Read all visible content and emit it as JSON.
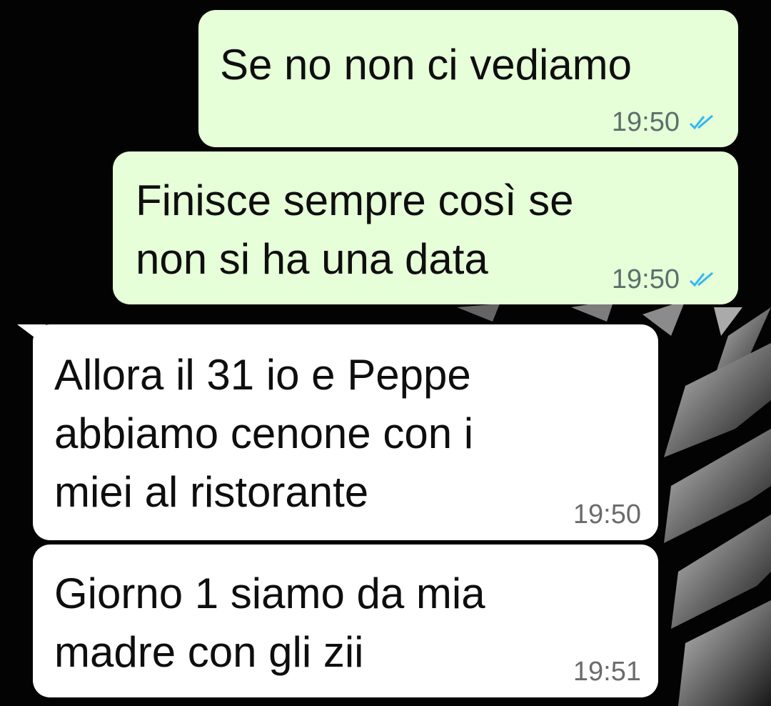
{
  "chat": {
    "messages": [
      {
        "direction": "out",
        "text": "Se no non ci vediamo",
        "time": "19:50",
        "status": "read",
        "status_icon": "double-check-icon"
      },
      {
        "direction": "out",
        "text": "Finisce sempre così se\nnon si ha una data",
        "time": "19:50",
        "status": "read",
        "status_icon": "double-check-icon"
      },
      {
        "direction": "in",
        "text": "Allora il 31 io e Peppe\nabbiamo cenone con i\nmiei al ristorante",
        "time": "19:50"
      },
      {
        "direction": "in",
        "text": "Giorno 1 siamo da mia\nmadre con gli zii",
        "time": "19:51"
      }
    ]
  },
  "colors": {
    "outgoing_bubble": "#e6ffd8",
    "incoming_bubble": "#ffffff",
    "read_ticks": "#34b7f1",
    "wallpaper": "#000000"
  }
}
